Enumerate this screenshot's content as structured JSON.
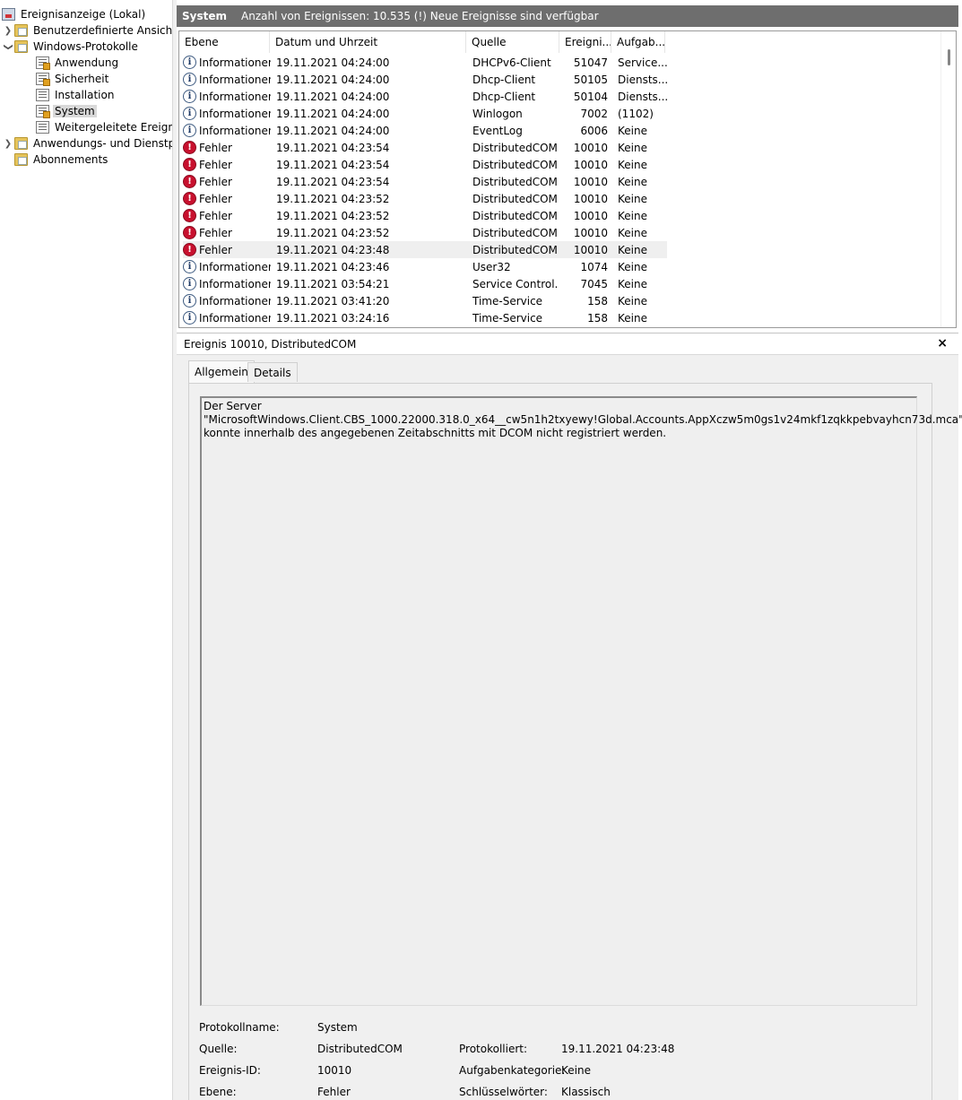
{
  "tree": {
    "root": "Ereignisanzeige (Lokal)",
    "custom_views": "Benutzerdefinierte Ansichten",
    "windows_logs": "Windows-Protokolle",
    "logs": [
      "Anwendung",
      "Sicherheit",
      "Installation",
      "System",
      "Weitergeleitete Ereignisse"
    ],
    "app_service_logs": "Anwendungs- und Dienstprotokolle",
    "subscriptions": "Abonnements"
  },
  "header": {
    "title": "System",
    "count_text": "Anzahl von Ereignissen: 10.535 (!) Neue Ereignisse sind verfügbar"
  },
  "columns": [
    "Ebene",
    "Datum und Uhrzeit",
    "Quelle",
    "Ereigni...",
    "Aufgab..."
  ],
  "events": [
    {
      "level": "Informationen",
      "type": "info",
      "date": "19.11.2021 04:24:00",
      "source": "DHCPv6-Client",
      "id": "51047",
      "task": "Service..."
    },
    {
      "level": "Informationen",
      "type": "info",
      "date": "19.11.2021 04:24:00",
      "source": "Dhcp-Client",
      "id": "50105",
      "task": "Diensts..."
    },
    {
      "level": "Informationen",
      "type": "info",
      "date": "19.11.2021 04:24:00",
      "source": "Dhcp-Client",
      "id": "50104",
      "task": "Diensts..."
    },
    {
      "level": "Informationen",
      "type": "info",
      "date": "19.11.2021 04:24:00",
      "source": "Winlogon",
      "id": "7002",
      "task": "(1102)"
    },
    {
      "level": "Informationen",
      "type": "info",
      "date": "19.11.2021 04:24:00",
      "source": "EventLog",
      "id": "6006",
      "task": "Keine"
    },
    {
      "level": "Fehler",
      "type": "error",
      "date": "19.11.2021 04:23:54",
      "source": "DistributedCOM",
      "id": "10010",
      "task": "Keine"
    },
    {
      "level": "Fehler",
      "type": "error",
      "date": "19.11.2021 04:23:54",
      "source": "DistributedCOM",
      "id": "10010",
      "task": "Keine"
    },
    {
      "level": "Fehler",
      "type": "error",
      "date": "19.11.2021 04:23:54",
      "source": "DistributedCOM",
      "id": "10010",
      "task": "Keine"
    },
    {
      "level": "Fehler",
      "type": "error",
      "date": "19.11.2021 04:23:52",
      "source": "DistributedCOM",
      "id": "10010",
      "task": "Keine"
    },
    {
      "level": "Fehler",
      "type": "error",
      "date": "19.11.2021 04:23:52",
      "source": "DistributedCOM",
      "id": "10010",
      "task": "Keine"
    },
    {
      "level": "Fehler",
      "type": "error",
      "date": "19.11.2021 04:23:52",
      "source": "DistributedCOM",
      "id": "10010",
      "task": "Keine"
    },
    {
      "level": "Fehler",
      "type": "error",
      "date": "19.11.2021 04:23:48",
      "source": "DistributedCOM",
      "id": "10010",
      "task": "Keine"
    },
    {
      "level": "Informationen",
      "type": "info",
      "date": "19.11.2021 04:23:46",
      "source": "User32",
      "id": "1074",
      "task": "Keine"
    },
    {
      "level": "Informationen",
      "type": "info",
      "date": "19.11.2021 03:54:21",
      "source": "Service Control...",
      "id": "7045",
      "task": "Keine"
    },
    {
      "level": "Informationen",
      "type": "info",
      "date": "19.11.2021 03:41:20",
      "source": "Time-Service",
      "id": "158",
      "task": "Keine"
    },
    {
      "level": "Informationen",
      "type": "info",
      "date": "19.11.2021 03:24:16",
      "source": "Time-Service",
      "id": "158",
      "task": "Keine"
    }
  ],
  "detail": {
    "title": "Ereignis 10010, DistributedCOM",
    "close": "×",
    "tabs": [
      "Allgemein",
      "Details"
    ],
    "message": "Der Server \"MicrosoftWindows.Client.CBS_1000.22000.318.0_x64__cw5n1h2txyewy!Global.Accounts.AppXczw5m0gs1v24mkf1zqkkpebvayhcn73d.mca\"\nkonnte innerhalb des angegebenen Zeitabschnitts mit DCOM nicht registriert werden.",
    "props": {
      "log_name_label": "Protokollname:",
      "log_name": "System",
      "source_label": "Quelle:",
      "source": "DistributedCOM",
      "logged_label": "Protokolliert:",
      "logged": "19.11.2021 04:23:48",
      "event_id_label": "Ereignis-ID:",
      "event_id": "10010",
      "task_cat_label": "Aufgabenkategorie:",
      "task_cat": "Keine",
      "level_label": "Ebene:",
      "level": "Fehler",
      "keywords_label": "Schlüsselwörter:",
      "keywords": "Klassisch"
    }
  },
  "colors": {
    "header_bg": "#6e6e6e",
    "error": "#c8102e",
    "selection": "#d9d9d9"
  }
}
